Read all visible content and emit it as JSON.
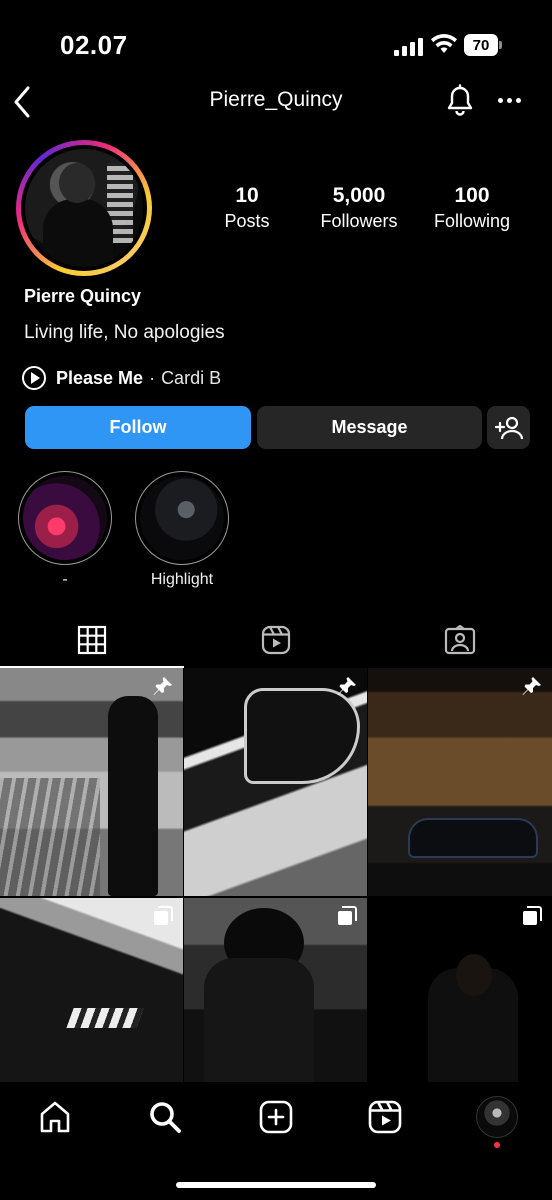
{
  "status": {
    "time": "02.07",
    "battery": "70"
  },
  "header": {
    "username": "Pierre_Quincy"
  },
  "profile": {
    "display_name": "Pierre Quincy",
    "bio": "Living life, No apologies",
    "music": {
      "song": "Please Me",
      "separator": "·",
      "artist": "Cardi B"
    }
  },
  "stats": [
    {
      "value": "10",
      "label": "Posts"
    },
    {
      "value": "5,000",
      "label": "Followers"
    },
    {
      "value": "100",
      "label": "Following"
    }
  ],
  "actions": {
    "follow": "Follow",
    "message": "Message"
  },
  "highlights": [
    {
      "label": "-"
    },
    {
      "label": "Highlight"
    }
  ],
  "tabs": [
    "grid-icon",
    "reels-icon",
    "tagged-icon"
  ],
  "grid_posts": [
    {
      "badge": "pin-icon"
    },
    {
      "badge": "pin-icon"
    },
    {
      "badge": "pin-icon"
    },
    {
      "badge": "multi-post-icon"
    },
    {
      "badge": "multi-post-icon"
    },
    {
      "badge": "multi-post-icon"
    }
  ],
  "nav": [
    "home-icon",
    "search-icon",
    "create-icon",
    "reels-icon",
    "profile-avatar"
  ],
  "colors": {
    "accent": "#2f96f6",
    "button_dark": "#262626",
    "background": "#000000",
    "notification_dot": "#ff3040"
  }
}
